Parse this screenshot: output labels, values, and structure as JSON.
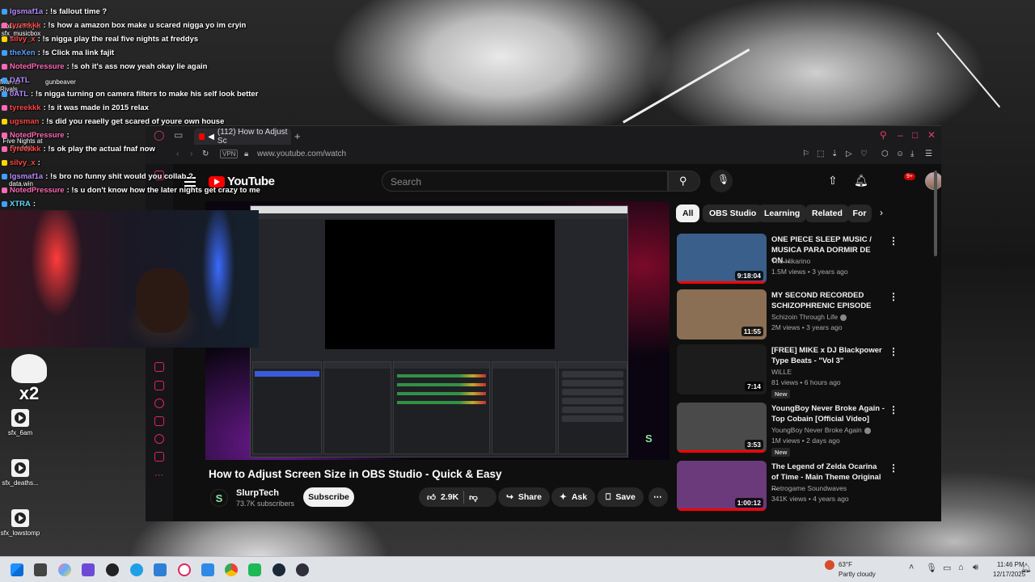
{
  "chat": [
    {
      "user": "lgsmaf1a",
      "msg": ": !s fallout time ?",
      "color": "#b98cff",
      "badge": "#3fa0ff"
    },
    {
      "user": "tyreekkk",
      "msg": ": !s how a amazon box make u scared nigga yo im cryin",
      "color": "#ff4545",
      "badge": "#ff69b4"
    },
    {
      "user": "silvy_x",
      "msg": ": !s nigga play the real five nights at freddys",
      "color": "#ff4545",
      "badge": "#ffd700"
    },
    {
      "user": "theXen",
      "msg": ": !s Click ma link fajit",
      "color": "#5aa0ff",
      "badge": "#3fa0ff"
    },
    {
      "user": "NotedPressure",
      "msg": ": !s oh it's ass now yeah okay lie again",
      "color": "#ff69b4",
      "badge": "#ff69b4"
    },
    {
      "user": "DATL",
      "msg": "",
      "color": "#b98cff",
      "badge": "#3fa0ff"
    },
    {
      "user": "0ATL",
      "msg": ": !s nigga turning on camera filters to make his self look better",
      "color": "#b98cff",
      "badge": "#3fa0ff"
    },
    {
      "user": "tyreekkk",
      "msg": ": !s it was made in 2015 relax",
      "color": "#ff4545",
      "badge": "#ff69b4"
    },
    {
      "user": "ugsman",
      "msg": ": !s did you reaelly get scared of youre own house",
      "color": "#ff4545",
      "badge": "#ffd700"
    },
    {
      "user": "NotedPressure",
      "msg": ":",
      "color": "#ff69b4",
      "badge": "#ff69b4"
    },
    {
      "user": "tyreekkk",
      "msg": ": !s ok play the actual fnaf now",
      "color": "#ff4545",
      "badge": "#ff69b4"
    },
    {
      "user": "silvy_x",
      "msg": ":",
      "color": "#ff4545",
      "badge": "#ffd700"
    },
    {
      "user": "lgsmaf1a",
      "msg": ": !s bro no funny shit would you collab ?",
      "color": "#b98cff",
      "badge": "#3fa0ff"
    },
    {
      "user": "NotedPressure",
      "msg": ": !s u don't know how the later nights get crazy to me",
      "color": "#ff69b4",
      "badge": "#ff69b4"
    },
    {
      "user": "XTRA",
      "msg": ":",
      "color": "#60d8ff",
      "badge": "#3fa0ff"
    }
  ],
  "desktop_icons": {
    "roblox": "Roblox Player sfx_musicbox",
    "marvel": "Marvel Rivals",
    "gunbeaver": "gunbeaver",
    "freddys": "Five Nights at Freddy's",
    "datawin": "data.win",
    "sfx_6am": "sfx_6am",
    "sfx_deaths": "sfx_deaths...",
    "sfx_lowstomp": "sfx_lowstomp",
    "x2": "x2"
  },
  "browser": {
    "tab_title": "(112) How to Adjust Sc",
    "vpn": "VPN",
    "url": "www.youtube.com/watch"
  },
  "youtube": {
    "logo": "YouTube",
    "search_placeholder": "Search",
    "notification_count": "9+",
    "video_title": "How to Adjust Screen Size in OBS Studio - Quick & Easy",
    "channel": "SlurpTech",
    "subscribers": "73.7K subscribers",
    "subscribe_label": "Subscribe",
    "likes": "2.9K",
    "share_label": "Share",
    "ask_label": "Ask",
    "save_label": "Save",
    "chips": [
      "All",
      "OBS Studio",
      "Learning",
      "Related",
      "For"
    ],
    "recommendations": [
      {
        "title": "ONE PIECE SLEEP MUSIC / MUSICA PARA DORMIR DE ON...",
        "channel": "The Hikarino",
        "meta": "1.5M views • 3 years ago",
        "duration": "9:18:04",
        "verified": false,
        "new": "",
        "thumb": "#3a5f8a"
      },
      {
        "title": "MY SECOND RECORDED SCHIZOPHRENIC EPISODE",
        "channel": "Schizoin Through Life",
        "meta": "2M views • 3 years ago",
        "duration": "11:55",
        "verified": true,
        "new": "",
        "thumb": "#8a6f55"
      },
      {
        "title": "[FREE] MIKE x DJ Blackpower Type Beats - \"Vol 3\"",
        "channel": "WiLLE",
        "meta": "81 views • 6 hours ago",
        "duration": "7:14",
        "verified": false,
        "new": "New",
        "thumb": "#1c1c1c"
      },
      {
        "title": "YoungBoy Never Broke Again - Top Cobain [Official Video]",
        "channel": "YoungBoy Never Broke Again",
        "meta": "1M views • 2 days ago",
        "duration": "3:53",
        "verified": true,
        "new": "New",
        "thumb": "#4a4a4a"
      },
      {
        "title": "The Legend of Zelda Ocarina of Time - Main Theme Original ...",
        "channel": "Retrogame Soundwaves",
        "meta": "341K views • 4 years ago",
        "duration": "1:00:12",
        "verified": false,
        "new": "",
        "thumb": "#6a3a7a"
      }
    ]
  },
  "taskbar": {
    "weather_temp": "63°F",
    "weather_desc": "Partly cloudy",
    "time": "11:46 PM",
    "date": "12/17/2025"
  }
}
